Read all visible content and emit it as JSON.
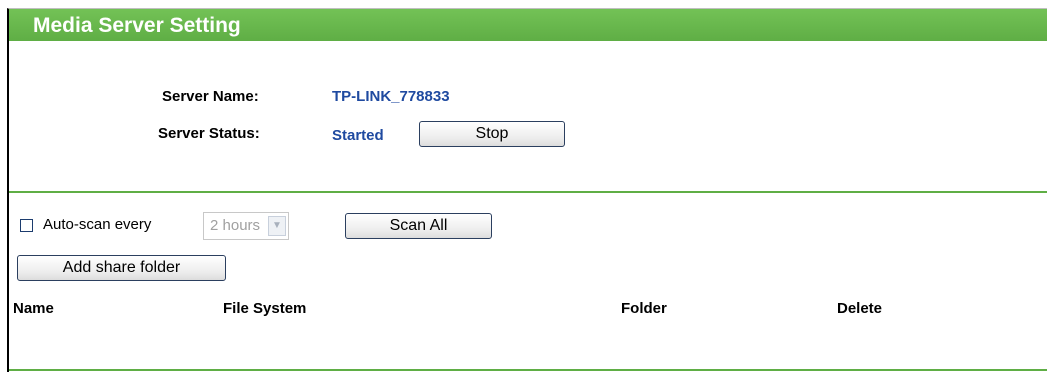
{
  "header": {
    "title": "Media Server Setting"
  },
  "server": {
    "name_label": "Server Name:",
    "name_value": "TP-LINK_778833",
    "status_label": "Server Status:",
    "status_value": "Started",
    "stop_button": "Stop"
  },
  "scan": {
    "autoscan_checked": false,
    "autoscan_label": "Auto-scan every",
    "interval_value": "2 hours",
    "scan_all_button": "Scan All",
    "add_share_button": "Add share folder"
  },
  "table": {
    "columns": [
      "Name",
      "File System",
      "Folder",
      "Delete"
    ],
    "rows": []
  },
  "colors": {
    "title_bar": "#66b84a",
    "value_text": "#1f4aa0",
    "divider": "#5fae45"
  },
  "icons": {
    "dropdown": "chevron-down-icon"
  }
}
